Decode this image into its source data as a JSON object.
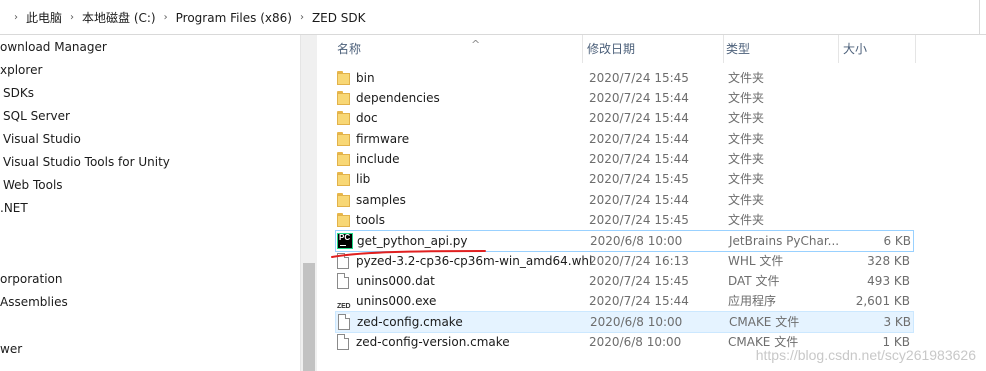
{
  "address_bar": {
    "crumbs": [
      "此电脑",
      "本地磁盘 (C:)",
      "Program Files (x86)",
      "ZED SDK"
    ]
  },
  "sidebar": {
    "items": [
      "ownload Manager",
      "xplorer",
      "SDKs",
      "SQL Server",
      "Visual Studio",
      "Visual Studio Tools for Unity",
      "Web Tools",
      ".NET",
      "",
      "",
      "orporation",
      "Assemblies",
      "",
      "wer"
    ]
  },
  "columns": {
    "name": "名称",
    "date": "修改日期",
    "type": "类型",
    "size": "大小"
  },
  "files": [
    {
      "name": "bin",
      "date": "2020/7/24 15:45",
      "type": "文件夹",
      "size": "",
      "icon": "folder-icon"
    },
    {
      "name": "dependencies",
      "date": "2020/7/24 15:44",
      "type": "文件夹",
      "size": "",
      "icon": "folder-icon"
    },
    {
      "name": "doc",
      "date": "2020/7/24 15:44",
      "type": "文件夹",
      "size": "",
      "icon": "folder-icon"
    },
    {
      "name": "firmware",
      "date": "2020/7/24 15:44",
      "type": "文件夹",
      "size": "",
      "icon": "folder-icon"
    },
    {
      "name": "include",
      "date": "2020/7/24 15:44",
      "type": "文件夹",
      "size": "",
      "icon": "folder-icon"
    },
    {
      "name": "lib",
      "date": "2020/7/24 15:45",
      "type": "文件夹",
      "size": "",
      "icon": "folder-icon"
    },
    {
      "name": "samples",
      "date": "2020/7/24 15:44",
      "type": "文件夹",
      "size": "",
      "icon": "folder-icon"
    },
    {
      "name": "tools",
      "date": "2020/7/24 15:45",
      "type": "文件夹",
      "size": "",
      "icon": "folder-icon"
    },
    {
      "name": "get_python_api.py",
      "date": "2020/6/8 10:00",
      "type": "JetBrains PyChar...",
      "size": "6 KB",
      "icon": "pycharm-file-icon"
    },
    {
      "name": "pyzed-3.2-cp36-cp36m-win_amd64.whl",
      "date": "2020/7/24 16:13",
      "type": "WHL 文件",
      "size": "328 KB",
      "icon": "file-icon"
    },
    {
      "name": "unins000.dat",
      "date": "2020/7/24 15:45",
      "type": "DAT 文件",
      "size": "493 KB",
      "icon": "file-icon"
    },
    {
      "name": "unins000.exe",
      "date": "2020/7/24 15:44",
      "type": "应用程序",
      "size": "2,601 KB",
      "icon": "zed-exe-icon"
    },
    {
      "name": "zed-config.cmake",
      "date": "2020/6/8 10:00",
      "type": "CMAKE 文件",
      "size": "3 KB",
      "icon": "file-icon"
    },
    {
      "name": "zed-config-version.cmake",
      "date": "2020/6/8 10:00",
      "type": "CMAKE 文件",
      "size": "1 KB",
      "icon": "file-icon"
    }
  ],
  "exe_icon_text": "ZED",
  "watermark": "https://blog.csdn.net/scy261983626",
  "colors": {
    "header_text": "#4c607a",
    "selection_bg": "#e5f3ff",
    "annotation_red": "#e02020",
    "folder": "#f8d775"
  }
}
